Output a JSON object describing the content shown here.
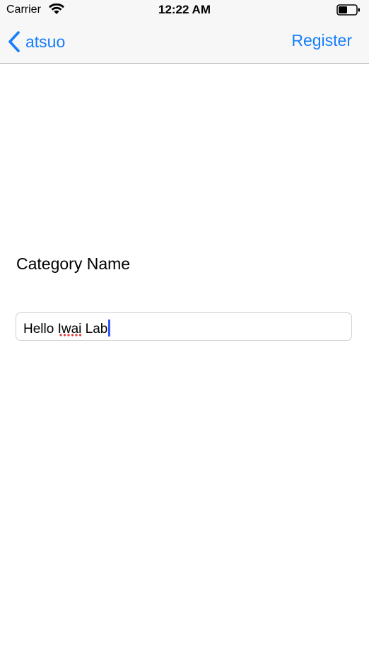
{
  "status_bar": {
    "carrier": "Carrier",
    "time": "12:22 AM",
    "wifi_icon": "wifi-icon",
    "battery_icon": "battery-icon",
    "battery_level": 0.5
  },
  "nav": {
    "back_label": "atsuo",
    "back_icon": "chevron-left-icon",
    "register_label": "Register",
    "accent_color": "#157efb"
  },
  "form": {
    "category_label": "Category Name",
    "category_value": "Hello Iwai Lab",
    "caret_color": "#3758f2",
    "spellcheck_underline_color": "#e2383a"
  }
}
